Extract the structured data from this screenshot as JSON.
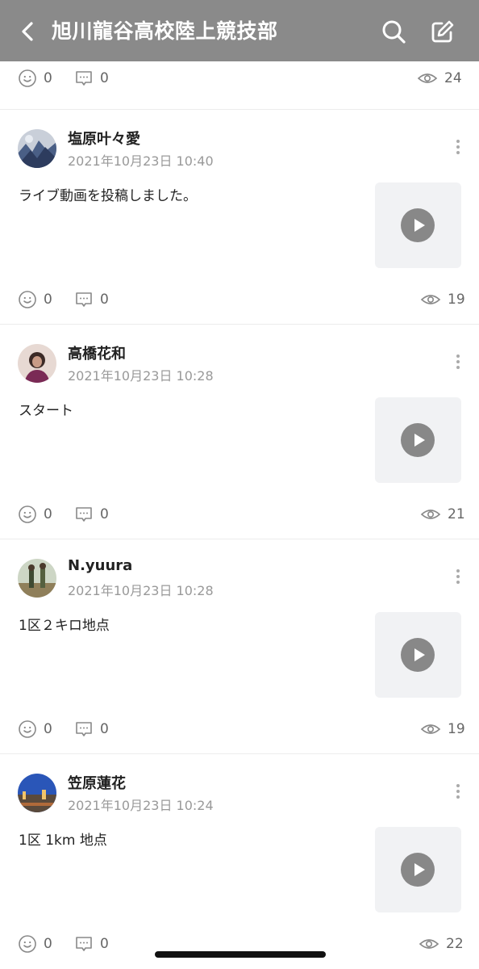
{
  "header": {
    "title": "旭川龍谷高校陸上競技部",
    "back_icon": "chevron-left-icon",
    "search_icon": "search-icon",
    "compose_icon": "compose-icon"
  },
  "top_stats": {
    "reactions": "0",
    "comments": "0",
    "views": "24"
  },
  "posts": [
    {
      "author": "塩原叶々愛",
      "date": "2021年10月23日 10:40",
      "text": "ライブ動画を投稿しました。",
      "reactions": "0",
      "comments": "0",
      "views": "19"
    },
    {
      "author": "高橋花和",
      "date": "2021年10月23日 10:28",
      "text": "スタート",
      "reactions": "0",
      "comments": "0",
      "views": "21"
    },
    {
      "author": "N.yuura",
      "date": "2021年10月23日 10:28",
      "text": "1区２キロ地点",
      "reactions": "0",
      "comments": "0",
      "views": "19"
    },
    {
      "author": "笠原蓮花",
      "date": "2021年10月23日 10:24",
      "text": "1区 1km 地点",
      "reactions": "0",
      "comments": "0",
      "views": "22"
    }
  ],
  "colors": {
    "header_bg": "#8a8a8a",
    "thumb_bg": "#f1f2f4",
    "play_icon": "#888888",
    "muted_text": "#999999"
  }
}
